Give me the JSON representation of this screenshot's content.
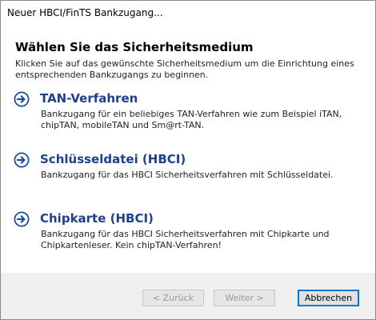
{
  "window": {
    "title": "Neuer HBCI/FinTS Bankzugang..."
  },
  "page": {
    "heading": "Wählen Sie das Sicherheitsmedium",
    "subtitle": "Klicken Sie auf das gewünschte Sicherheitsmedium um die Einrichtung eines entsprechenden Bankzugangs zu beginnen."
  },
  "options": [
    {
      "title": "TAN-Verfahren",
      "description": "Bankzugang für ein beliebiges TAN-Verfahren wie zum Beispiel iTAN, chipTAN, mobileTAN und Sm@rt-TAN.",
      "icon": "arrow-right-circle-icon"
    },
    {
      "title": "Schlüsseldatei (HBCI)",
      "description": "Bankzugang für das HBCI Sicherheitsverfahren mit Schlüsseldatei.",
      "icon": "arrow-right-circle-icon"
    },
    {
      "title": "Chipkarte (HBCI)",
      "description": "Bankzugang für das HBCI Sicherheitsverfahren mit Chipkarte und Chipkartenleser. Kein chipTAN-Verfahren!",
      "icon": "arrow-right-circle-icon"
    }
  ],
  "buttons": {
    "back": "< Zurück",
    "next": "Weiter >",
    "cancel": "Abbrechen"
  },
  "colors": {
    "option_title": "#1e3f8a",
    "arrow": "#1f4e9c",
    "default_button_border": "#0078d7"
  }
}
